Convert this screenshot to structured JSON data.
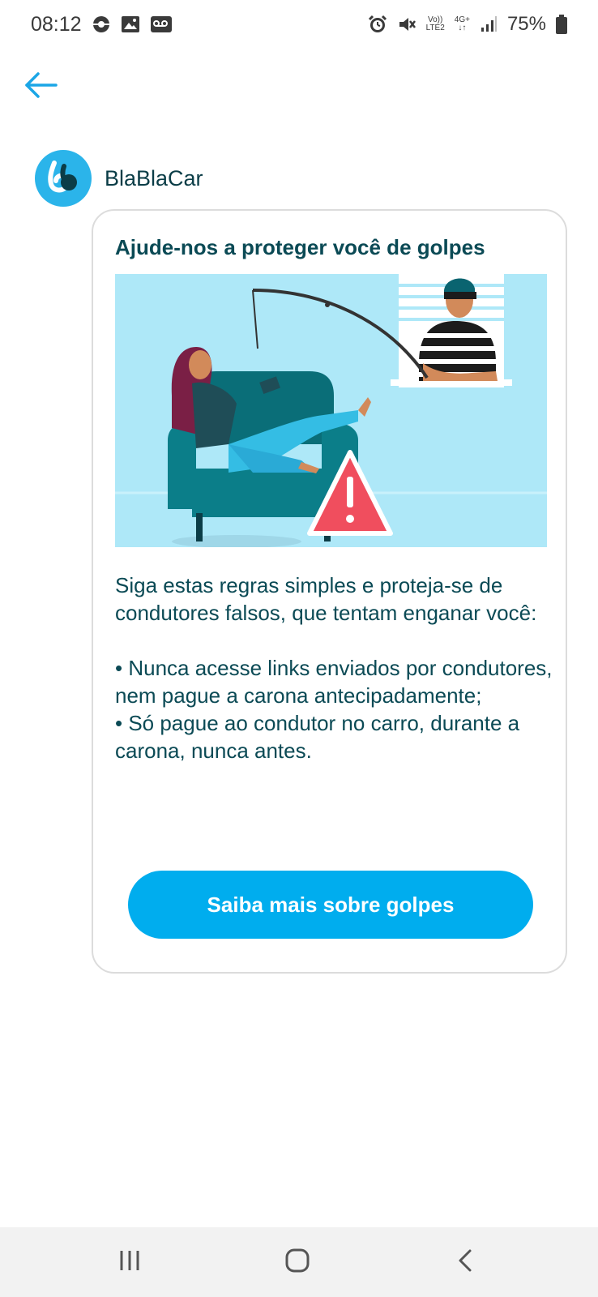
{
  "status_bar": {
    "time": "08:12",
    "volte_label": "Vo))",
    "lte_label": "LTE2",
    "network_label": "4G+",
    "battery_percent": "75%",
    "icons": [
      "camera-notification-icon",
      "image-icon",
      "voicemail-icon",
      "alarm-icon",
      "mute-icon",
      "signal-icon",
      "battery-icon"
    ]
  },
  "header": {
    "back_icon": "back-arrow-icon"
  },
  "message": {
    "sender_name": "BlaBlaCar",
    "avatar_icon": "blablacar-logo",
    "title": "Ajude-nos a proteger você de golpes",
    "illustration": "scam-warning-illustration",
    "intro": "Siga estas regras simples e proteja-se de condutores falsos, que tentam enganar você:",
    "rule_1": "• Nunca acesse links enviados por condutores, nem pague a carona antecipadamente;",
    "rule_2": "• Só pague ao condutor no carro, durante a carona, nunca antes.",
    "button_label": "Saiba mais sobre golpes"
  },
  "nav_bar": {
    "icons": [
      "recent-apps-icon",
      "home-icon",
      "back-icon"
    ]
  },
  "colors": {
    "accent": "#00adee",
    "text": "#0b4a55",
    "illustration_bg": "#aee8f8",
    "warning": "#f04e5e"
  }
}
